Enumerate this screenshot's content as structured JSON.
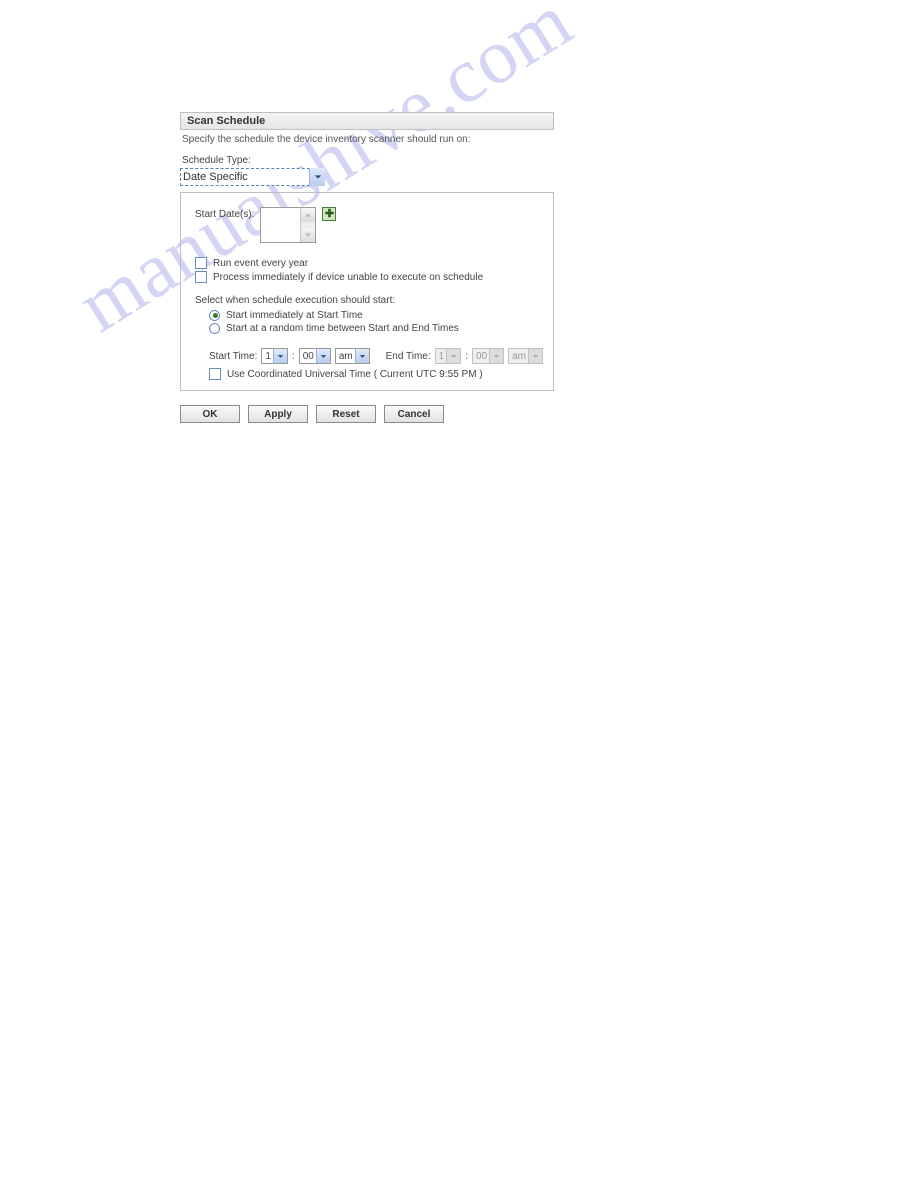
{
  "header": {
    "title": "Scan Schedule"
  },
  "intro": "Specify the schedule the device inventory scanner should run on:",
  "schedule_type": {
    "label": "Schedule Type:",
    "value": "Date Specific"
  },
  "start_dates": {
    "label": "Start Date(s):",
    "add_icon": "plus-icon"
  },
  "checks": {
    "every_year": "Run event every year",
    "process_immediately": "Process immediately if device unable to execute on schedule"
  },
  "exec_start": {
    "label": "Select when schedule execution should start:",
    "opt_immediate": "Start immediately at Start Time",
    "opt_random": "Start at a random time between Start and End Times"
  },
  "times": {
    "start_label": "Start Time:",
    "start_hour": "1",
    "start_min": "00",
    "start_ampm": "am",
    "colon": ":",
    "end_label": "End Time:",
    "end_hour": "1",
    "end_min": "00",
    "end_ampm": "am"
  },
  "utc": {
    "label": "Use Coordinated Universal Time ( Current UTC 9:55 PM )"
  },
  "buttons": {
    "ok": "OK",
    "apply": "Apply",
    "reset": "Reset",
    "cancel": "Cancel"
  },
  "watermark": "manualshive.com"
}
